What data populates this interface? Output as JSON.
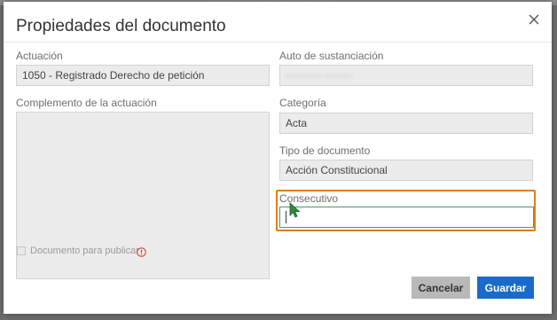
{
  "background": {
    "text": "··· ··· ··········· ··· ······ ········ ·······"
  },
  "dialog": {
    "title": "Propiedades del documento",
    "close_icon": "close-icon"
  },
  "form": {
    "actuacion": {
      "label": "Actuación",
      "value": "1050 - Registrado Derecho de petición"
    },
    "auto_sustanciacion": {
      "label": "Auto de sustanciación",
      "value": "·········· ········"
    },
    "complemento": {
      "label": "Complemento de la actuación",
      "value": ""
    },
    "categoria": {
      "label": "Categoría",
      "value": "Acta"
    },
    "tipo_documento": {
      "label": "Tipo de documento",
      "value": "Acción Constitucional"
    },
    "consecutivo": {
      "label": "Consecutivo",
      "value": "",
      "placeholder": ""
    },
    "publicar": {
      "label": "Documento para publicar",
      "checked": false,
      "icon": "info-icon"
    }
  },
  "buttons": {
    "cancel": "Cancelar",
    "save": "Guardar"
  },
  "colors": {
    "primary": "#1a6bc9",
    "highlight": "#e07d1b",
    "info": "#d9342b",
    "cursor": "#2e8b3a"
  }
}
